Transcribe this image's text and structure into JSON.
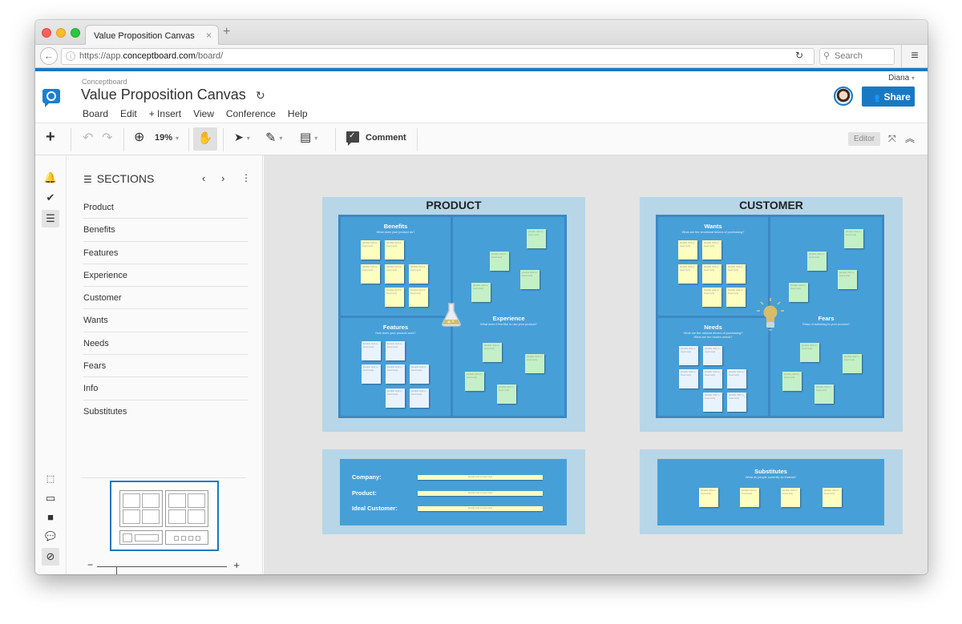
{
  "browser": {
    "tab_title": "Value Proposition Canvas",
    "tab_close": "×",
    "new_tab": "+",
    "url_prefix": "https://app.",
    "url_domain": "conceptboard.com",
    "url_path": "/board/",
    "search_placeholder": "Search",
    "icons": {
      "back": "←",
      "info": "i",
      "reload": "↻",
      "search": "⚲",
      "menu": "≡"
    }
  },
  "header": {
    "brand": "Conceptboard",
    "board_title": "Value Proposition Canvas",
    "sync_icon": "↻",
    "menu": [
      "Board",
      "Edit",
      "+ Insert",
      "View",
      "Conference",
      "Help"
    ],
    "user_name": "Diana",
    "user_caret": "▾",
    "share_label": "Share",
    "share_icon": "👥"
  },
  "toolbar": {
    "add": "+",
    "undo": "↶",
    "redo": "↷",
    "zoom_icon": "⊕",
    "zoom_value": "19%",
    "caret": "▾",
    "hand": "✋",
    "select": "➤",
    "pen": "✎",
    "note": "▤",
    "comment_label": "Comment",
    "comment_check": "✓",
    "editor_label": "Editor",
    "fullscreen": "⤧",
    "collapse": "︽"
  },
  "rail": {
    "top": [
      {
        "name": "notifications",
        "glyph": "🔔"
      },
      {
        "name": "tasks",
        "glyph": "✔"
      },
      {
        "name": "sections",
        "glyph": "☰",
        "active": true
      }
    ],
    "bottom": [
      {
        "name": "selection",
        "glyph": "⬚"
      },
      {
        "name": "presentation",
        "glyph": "▭"
      },
      {
        "name": "video",
        "glyph": "■"
      },
      {
        "name": "chat",
        "glyph": "💬"
      },
      {
        "name": "navigator",
        "glyph": "⊘",
        "active": true
      }
    ]
  },
  "sections": {
    "title": "SECTIONS",
    "list_icon": "☰",
    "prev": "‹",
    "next": "›",
    "more": "⋮",
    "items": [
      "Product",
      "Benefits",
      "Features",
      "Experience",
      "Customer",
      "Wants",
      "Needs",
      "Fears",
      "Info",
      "Substitutes"
    ],
    "zoom_minus": "−",
    "zoom_plus": "+",
    "zoom_level": 0.15
  },
  "board": {
    "note_placeholder": "[double click to insert text]",
    "product": {
      "title": "PRODUCT",
      "benefits": {
        "title": "Benefits",
        "subtitle": "What does your product do?"
      },
      "features": {
        "title": "Features",
        "subtitle": "How does your product work?"
      },
      "experience": {
        "title": "Experience",
        "subtitle": "What does it feel like to use your product?"
      }
    },
    "customer": {
      "title": "CUSTOMER",
      "wants": {
        "title": "Wants",
        "subtitle": "What are the emotional drivers of purchasing?"
      },
      "needs": {
        "title": "Needs",
        "subtitle1": "What are the rational drivers of purchasing?",
        "subtitle2": "What are the hidden needs?"
      },
      "fears": {
        "title": "Fears",
        "subtitle": "Risks of switching to your product?"
      }
    },
    "info": {
      "labels": [
        "Company:",
        "Product:",
        "Ideal Customer:"
      ]
    },
    "substitutes": {
      "title": "Substitutes",
      "subtitle": "What do people currently do instead?"
    }
  }
}
